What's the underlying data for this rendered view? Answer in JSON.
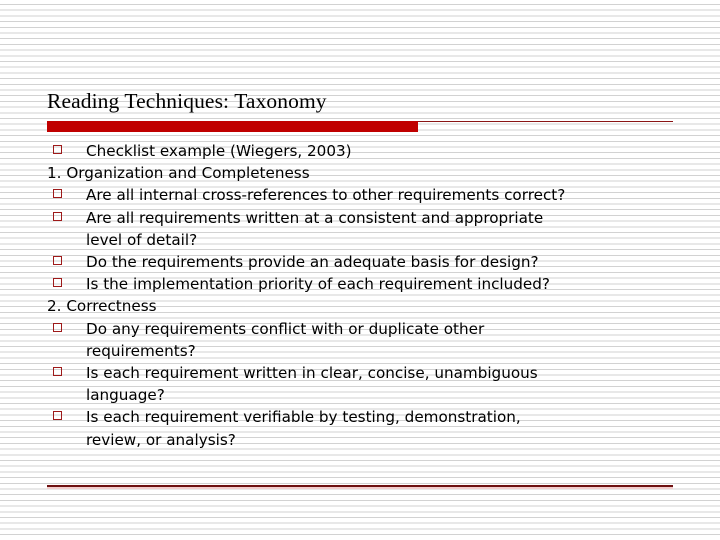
{
  "slide": {
    "title": "Reading Techniques: Taxonomy",
    "accent_color": "#c00000",
    "accent_rule_color": "#8a1414",
    "bullet_marker_color": "#9e1a1a",
    "bottom_rule_color": "#6d1111",
    "text_color": "#000000",
    "background_color": "#ffffff"
  },
  "content": {
    "lines": [
      {
        "kind": "bullet",
        "text": "Checklist example (Wiegers, 2003)"
      },
      {
        "kind": "numbered",
        "text": "1. Organization and Completeness"
      },
      {
        "kind": "bullet",
        "text": "Are all internal cross-references to other requirements correct?"
      },
      {
        "kind": "bullet",
        "text": " Are all requirements written at a consistent and appropriate"
      },
      {
        "kind": "cont",
        "text": "level of detail?"
      },
      {
        "kind": "bullet",
        "text": "Do the requirements provide an adequate basis for design?"
      },
      {
        "kind": "bullet",
        "text": "Is the implementation priority of each requirement included?"
      },
      {
        "kind": "numbered",
        "text": "2. Correctness"
      },
      {
        "kind": "bullet",
        "text": "Do any requirements conflict with or duplicate other"
      },
      {
        "kind": "cont",
        "text": "requirements?"
      },
      {
        "kind": "bullet",
        "text": "Is each requirement written in clear, concise, unambiguous"
      },
      {
        "kind": "cont",
        "text": "language?"
      },
      {
        "kind": "bullet",
        "text": "Is each requirement verifiable by testing, demonstration,"
      },
      {
        "kind": "cont",
        "text": "review, or analysis?"
      }
    ]
  }
}
